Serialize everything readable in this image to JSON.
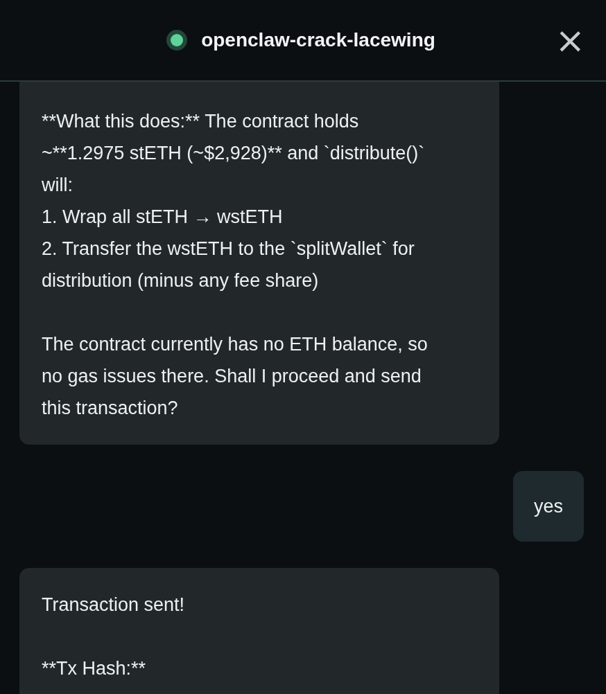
{
  "header": {
    "online": true,
    "title": "openclaw-crack-lacewing",
    "close": "×"
  },
  "messages": [
    {
      "from_user": false,
      "continued": true,
      "blocks": [
        {
          "kind": "para",
          "text": "**What this does:** The contract holds ~**1.2975 stETH (~$2,928)** and `distribute()` will:"
        },
        {
          "kind": "item",
          "text": "1. Wrap all stETH → wstETH"
        },
        {
          "kind": "item",
          "text": "2. Transfer the wstETH to the `splitWallet` for distribution (minus any fee share)"
        },
        {
          "kind": "gap"
        },
        {
          "kind": "para",
          "text": "The contract currently has no ETH balance, so no gas issues there. Shall I proceed and send this transaction?"
        }
      ]
    },
    {
      "from_user": true,
      "continued": false,
      "blocks": [
        {
          "kind": "para",
          "text": "yes"
        }
      ]
    },
    {
      "from_user": false,
      "continued": false,
      "blocks": [
        {
          "kind": "para",
          "text": "Transaction sent!"
        },
        {
          "kind": "gap"
        },
        {
          "kind": "para",
          "text": "**Tx Hash:**"
        }
      ]
    }
  ]
}
